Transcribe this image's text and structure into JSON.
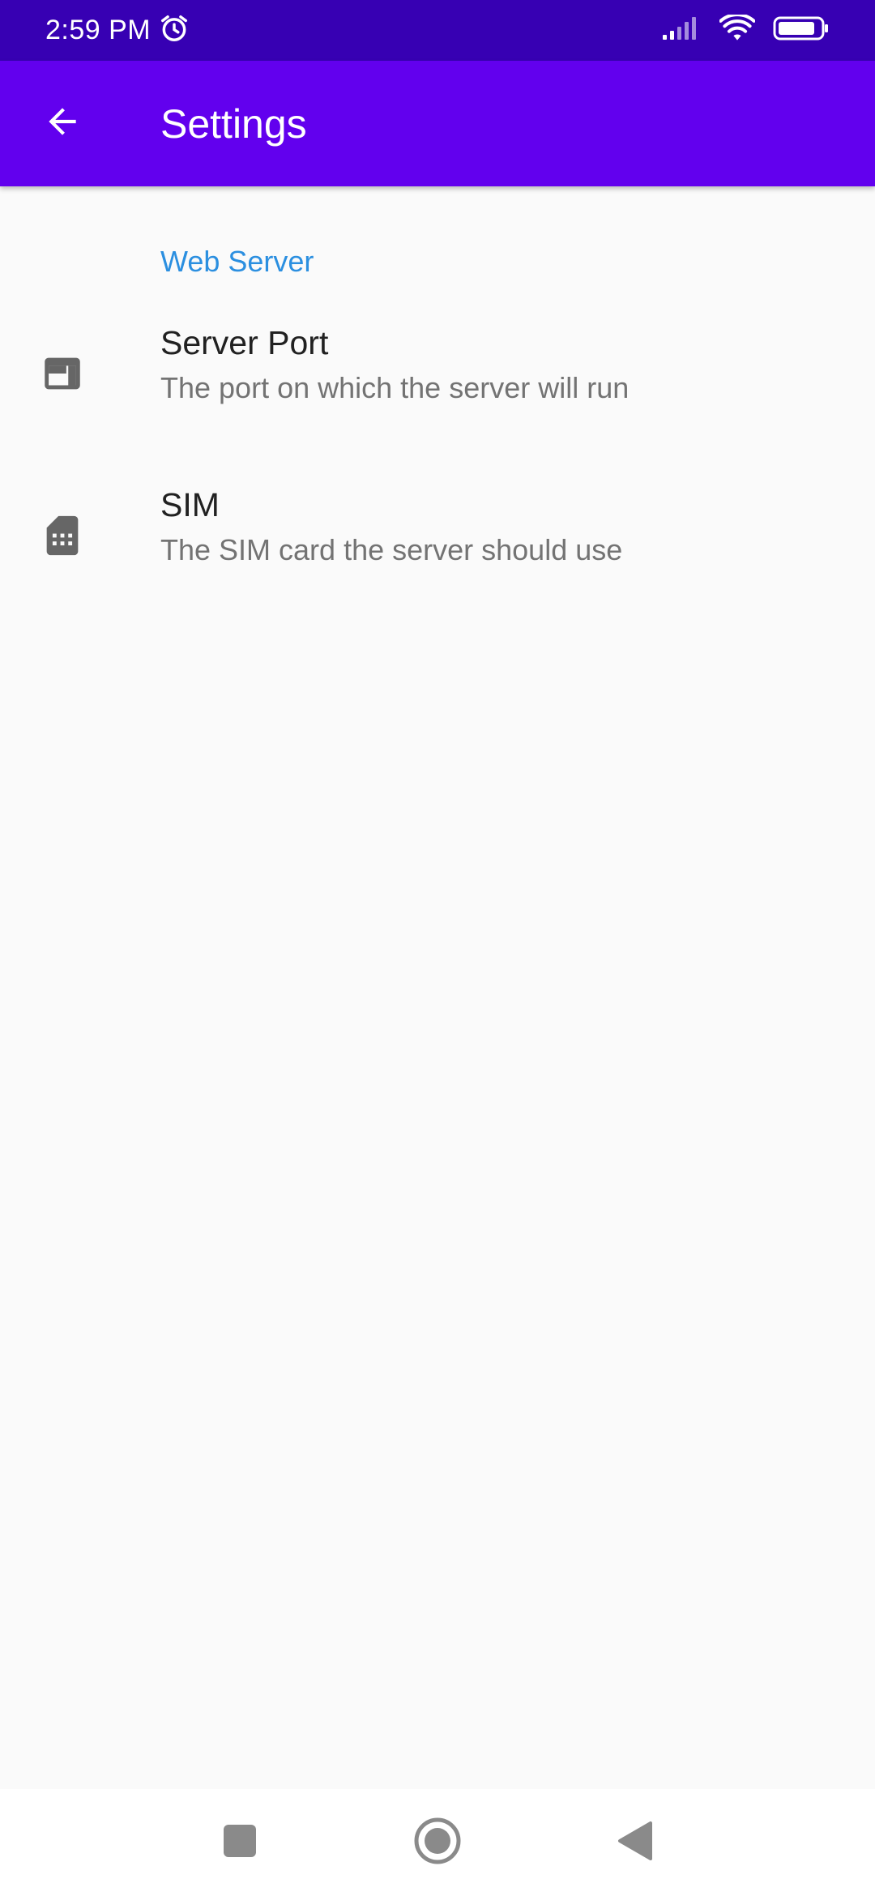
{
  "status_bar": {
    "time": "2:59 PM",
    "icons": [
      "alarm-icon",
      "signal-icon",
      "wifi-icon",
      "battery-icon"
    ]
  },
  "app_bar": {
    "title": "Settings",
    "back_icon": "arrow-back-icon",
    "background": "#6200ee",
    "status_background": "#3700b3"
  },
  "preferences": {
    "category_title": "Web Server",
    "category_color": "#2b8fe0",
    "items": [
      {
        "icon": "web-asset-icon",
        "title": "Server Port",
        "summary": "The port on which the server will run"
      },
      {
        "icon": "sim-card-icon",
        "title": "SIM",
        "summary": "The SIM card the server should use"
      }
    ]
  },
  "nav_bar": {
    "buttons": [
      "recents-icon",
      "home-icon",
      "back-icon"
    ]
  }
}
